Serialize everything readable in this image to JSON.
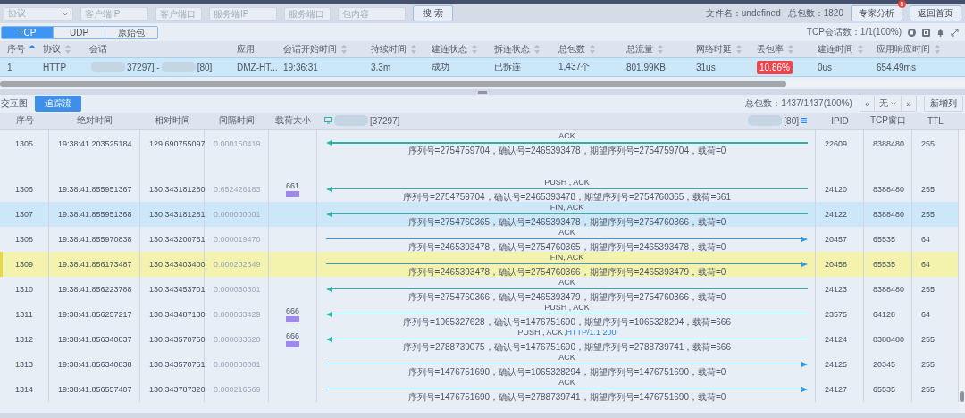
{
  "filter_bar": {
    "protocol": {
      "placeholder": "协议"
    },
    "fields": [
      {
        "placeholder": "客户端IP",
        "kind": "wide"
      },
      {
        "placeholder": "客户端口",
        "kind": "narrow"
      },
      {
        "placeholder": "服务端IP",
        "kind": "wide"
      },
      {
        "placeholder": "服务端口",
        "kind": "narrow"
      },
      {
        "placeholder": "包内容",
        "kind": "wide"
      }
    ],
    "search_button": "搜 索",
    "file_name": "文件名：undefined",
    "total_packets": "总包数：1820",
    "expert_button": {
      "label": "专家分析",
      "badge": "5"
    },
    "home_button": "返回首页"
  },
  "tabs": [
    {
      "label": "TCP",
      "selected": true
    },
    {
      "label": "UDP",
      "selected": false
    },
    {
      "label": "原始包",
      "selected": false
    }
  ],
  "session_count": "TCP会话数：1/1(100%)",
  "session_table": {
    "columns": [
      {
        "label": "序号",
        "sortable": true,
        "sorted": true
      },
      {
        "label": "协议",
        "sortable": true,
        "sorted": false
      },
      {
        "label": "会话",
        "sortable": false
      },
      {
        "label": "应用",
        "sortable": false
      },
      {
        "label": "会话开始时间",
        "sortable": true,
        "sorted": false
      },
      {
        "label": "持续时间",
        "sortable": true,
        "sorted": false
      },
      {
        "label": "建连状态",
        "sortable": true,
        "sorted": false
      },
      {
        "label": "拆连状态",
        "sortable": true,
        "sorted": false
      },
      {
        "label": "总包数",
        "sortable": true,
        "sorted": false
      },
      {
        "label": "总流量",
        "sortable": true,
        "sorted": false
      },
      {
        "label": "网络时延",
        "sortable": true,
        "sorted": false
      },
      {
        "label": "丢包率",
        "sortable": true,
        "sorted": false
      },
      {
        "label": "建连时间",
        "sortable": true,
        "sorted": false
      },
      {
        "label": "应用响应时间",
        "sortable": true,
        "sorted": false
      }
    ],
    "rows": [
      {
        "selected": true,
        "cells": [
          {
            "kind": "text",
            "text": "1"
          },
          {
            "kind": "text",
            "text": "HTTP"
          },
          {
            "kind": "masked",
            "parts": [
              "37297] -",
              "[80]"
            ]
          },
          {
            "kind": "text",
            "text": "DMZ-HT..."
          },
          {
            "kind": "text",
            "text": "19:36:31"
          },
          {
            "kind": "text",
            "text": "3.3m"
          },
          {
            "kind": "text",
            "text": "成功"
          },
          {
            "kind": "text",
            "text": "已拆连"
          },
          {
            "kind": "text",
            "text": "1,437个"
          },
          {
            "kind": "text",
            "text": "801.99KB"
          },
          {
            "kind": "text",
            "text": "31us"
          },
          {
            "kind": "badge",
            "text": "10.86%"
          },
          {
            "kind": "text",
            "text": "0us"
          },
          {
            "kind": "text",
            "text": "654.49ms"
          }
        ]
      }
    ]
  },
  "toolbar": {
    "title": "交互图",
    "trace_button": "追踪流",
    "total": "总包数：1437/1437(100%)",
    "pager": {
      "prev": "«",
      "value": "无",
      "next": "»"
    },
    "add_column_button": "新增列"
  },
  "packet_table": {
    "columns": [
      "序号",
      "绝对时间",
      "相对时间",
      "间隔时间",
      "载荷大小"
    ],
    "client": "[37297]",
    "server": "[80]",
    "extra_columns": [
      "IPID",
      "TCP窗口",
      "TTL"
    ],
    "rows": [
      {
        "no": "1305",
        "abs": "19:38:41.203525184",
        "rel": "129.690755097",
        "delta": "0.000150419",
        "flags": "ACK",
        "detail": "序列号=2754759704，确认号=2465393478，期望序列号=2754759704，载荷=0",
        "kind": "to_client",
        "ipid": "22609",
        "window": "8388480",
        "ttl": "255",
        "selected": false,
        "marked": false
      },
      {
        "no": "1306",
        "abs": "19:38:41.855951367",
        "rel": "130.343181280",
        "delta": "0.652426183",
        "payload": "661",
        "flags": "PUSH , ACK",
        "detail": "序列号=2754759704，确认号=2465393478，期望序列号=2754760365，载荷=661",
        "kind": "to_client",
        "ipid": "24120",
        "window": "8388480",
        "ttl": "255",
        "selected": false,
        "marked": false
      },
      {
        "no": "1307",
        "abs": "19:38:41.855951368",
        "rel": "130.343181281",
        "delta": "0.000000001",
        "flags": "FIN, ACK",
        "detail": "序列号=2754760365，确认号=2465393478，期望序列号=2754760366，载荷=0",
        "kind": "to_client",
        "ipid": "24122",
        "window": "8388480",
        "ttl": "255",
        "selected": true,
        "marked": false
      },
      {
        "no": "1308",
        "abs": "19:38:41.855970838",
        "rel": "130.343200751",
        "delta": "0.000019470",
        "flags": "ACK",
        "detail": "序列号=2465393478，确认号=2754760365，期望序列号=2465393478，载荷=0",
        "kind": "to_server",
        "ipid": "20457",
        "window": "65535",
        "ttl": "64",
        "selected": false,
        "marked": false
      },
      {
        "no": "1309",
        "abs": "19:38:41.856173487",
        "rel": "130.343403400",
        "delta": "0.000202649",
        "flags": "FIN, ACK",
        "detail": "序列号=2465393478，确认号=2754760366，期望序列号=2465393479，载荷=0",
        "kind": "to_server",
        "ipid": "20458",
        "window": "65535",
        "ttl": "64",
        "selected": false,
        "marked": true
      },
      {
        "no": "1310",
        "abs": "19:38:41.856223788",
        "rel": "130.343453701",
        "delta": "0.000050301",
        "flags": "ACK",
        "detail": "序列号=2754760366，确认号=2465393479，期望序列号=2754760366，载荷=0",
        "kind": "to_client",
        "ipid": "24123",
        "window": "8388480",
        "ttl": "255",
        "selected": false,
        "marked": false
      },
      {
        "no": "1311",
        "abs": "19:38:41.856257217",
        "rel": "130.343487130",
        "delta": "0.000033429",
        "payload": "666",
        "flags": "PUSH , ACK",
        "detail": "序列号=1065327628，确认号=1476751690，期望序列号=1065328294，载荷=666",
        "kind": "to_client",
        "ipid": "23575",
        "window": "64128",
        "ttl": "64",
        "selected": false,
        "marked": false
      },
      {
        "no": "1312",
        "abs": "19:38:41.856340837",
        "rel": "130.343570750",
        "delta": "0.000083620",
        "payload": "666",
        "flags": "PUSH , ACK",
        "info": ",HTTP/1.1 200",
        "detail": "序列号=2788739075，确认号=1476751690，期望序列号=2788739741，载荷=666",
        "kind": "to_client",
        "ipid": "24124",
        "window": "8388480",
        "ttl": "255",
        "selected": false,
        "marked": false
      },
      {
        "no": "1313",
        "abs": "19:38:41.856340838",
        "rel": "130.343570751",
        "delta": "0.000000001",
        "flags": "ACK",
        "detail": "序列号=1476751690，确认号=1065328294，期望序列号=1476751690，载荷=0",
        "kind": "to_server",
        "ipid": "24125",
        "window": "20345",
        "ttl": "255",
        "selected": false,
        "marked": false
      },
      {
        "no": "1314",
        "abs": "19:38:41.856557407",
        "rel": "130.343787320",
        "delta": "0.000216569",
        "flags": "ACK",
        "detail": "序列号=1476751690，确认号=2788739741，期望序列号=1476751690，载荷=0",
        "kind": "to_server",
        "ipid": "24127",
        "window": "65535",
        "ttl": "255",
        "selected": false,
        "marked": false
      }
    ]
  }
}
